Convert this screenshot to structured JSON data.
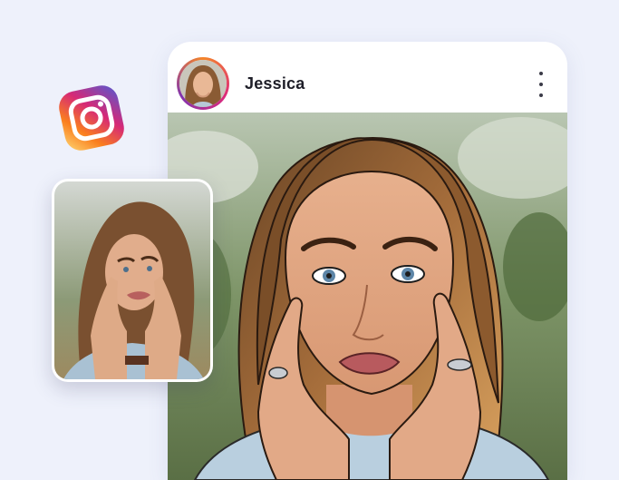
{
  "post": {
    "username": "Jessica",
    "avatar_icon": "profile-avatar-icon",
    "menu_icon": "more-vertical-icon"
  },
  "logos": {
    "app_logo": "instagram-logo-icon"
  },
  "colors": {
    "background": "#eef1fb",
    "card": "#ffffff",
    "accent_gradient": [
      "#f58529",
      "#dd2a7b",
      "#8134af"
    ],
    "text": "#1e1e28"
  }
}
